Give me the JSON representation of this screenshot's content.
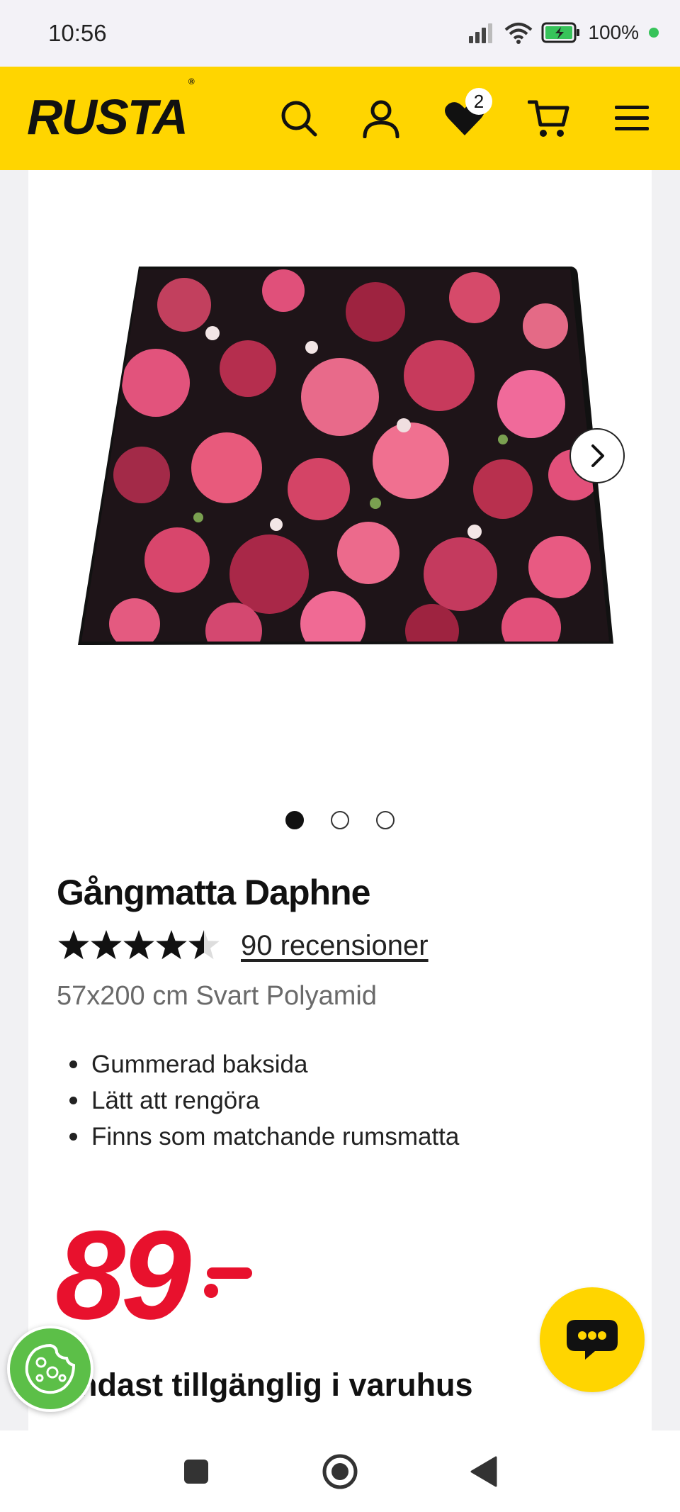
{
  "status_bar": {
    "time": "10:56",
    "battery": "100%"
  },
  "header": {
    "logo": "RUSTA",
    "icons": [
      "search-icon",
      "user-icon",
      "heart-icon",
      "cart-icon",
      "menu-icon"
    ],
    "wishlist_count": "2",
    "brand_color": "#ffd500"
  },
  "product": {
    "image_dots": 3,
    "active_dot": 1,
    "title": "Gångmatta Daphne",
    "rating": 4.5,
    "reviews": "90 recensioner",
    "subtitle": "57x200 cm Svart Polyamid",
    "features": [
      "Gummerad baksida",
      "Lätt att rengöra",
      "Finns som matchande rumsmatta"
    ],
    "price": "89",
    "price_suffix": "-",
    "price_color": "#e8112d",
    "availability": "Endast tillgänglig i varuhus"
  },
  "floating": {
    "chat": "chat-icon",
    "cookie": "cookie-icon"
  },
  "nav_bar": {
    "buttons": [
      "recents-icon",
      "home-icon",
      "back-icon"
    ]
  }
}
